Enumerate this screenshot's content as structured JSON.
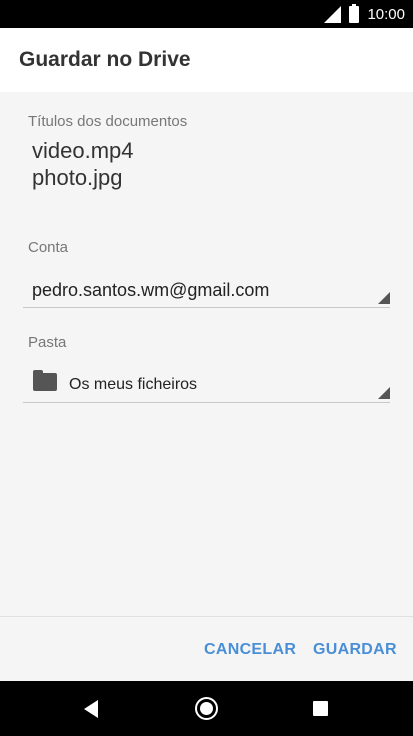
{
  "status_bar": {
    "time": "10:00"
  },
  "dialog": {
    "title": "Guardar no Drive",
    "documents": {
      "label": "Títulos dos documentos",
      "items": [
        "video.mp4",
        "photo.jpg"
      ]
    },
    "account": {
      "label": "Conta",
      "value": "pedro.santos.wm@gmail.com"
    },
    "folder": {
      "label": "Pasta",
      "value": "Os meus ficheiros"
    },
    "actions": {
      "cancel": "CANCELAR",
      "save": "GUARDAR"
    }
  },
  "icons": {
    "signal": "signal-icon",
    "battery": "battery-icon",
    "folder": "folder-icon",
    "dropdown": "dropdown-triangle-icon",
    "back": "back-icon",
    "home": "home-icon",
    "recent": "recent-apps-icon"
  },
  "colors": {
    "accent": "#4a8fd6",
    "background": "#f5f5f5",
    "header": "#ffffff"
  }
}
